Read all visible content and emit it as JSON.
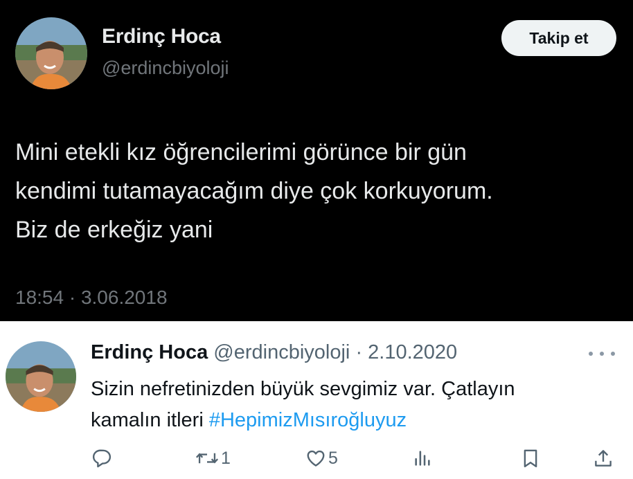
{
  "embedded_tweet": {
    "author_name": "Erdinç Hoca",
    "author_handle": "@erdincbiyoloji",
    "follow_label": "Takip et",
    "text_lines": [
      "Mini etekli kız öğrencilerimi görünce bir gün",
      "kendimi tutamayacağım diye çok korkuyorum.",
      "Biz de erkeğiz yani"
    ],
    "timestamp": "18:54 · 3.06.2018"
  },
  "reply_tweet": {
    "author_name": "Erdinç Hoca",
    "author_handle": "@erdincbiyoloji",
    "separator": "·",
    "date": "2.10.2020",
    "text_line_1": "Sizin nefretinizden büyük sevgimiz var. Çatlayın",
    "text_line_2_prefix": "kamalın itleri ",
    "hashtag": "#HepimizMısıroğluyuz",
    "actions": {
      "reply_icon": "reply-icon",
      "retweet_icon": "retweet-icon",
      "retweet_count": "1",
      "like_icon": "heart-icon",
      "like_count": "5",
      "views_icon": "views-icon",
      "bookmark_icon": "bookmark-icon",
      "share_icon": "share-icon"
    }
  },
  "colors": {
    "dark_bg": "#000000",
    "dark_text": "#e7e9ea",
    "muted": "#71767b",
    "light_muted": "#536471",
    "hashtag_blue": "#1d9bf0",
    "button_bg": "#eff3f4"
  }
}
